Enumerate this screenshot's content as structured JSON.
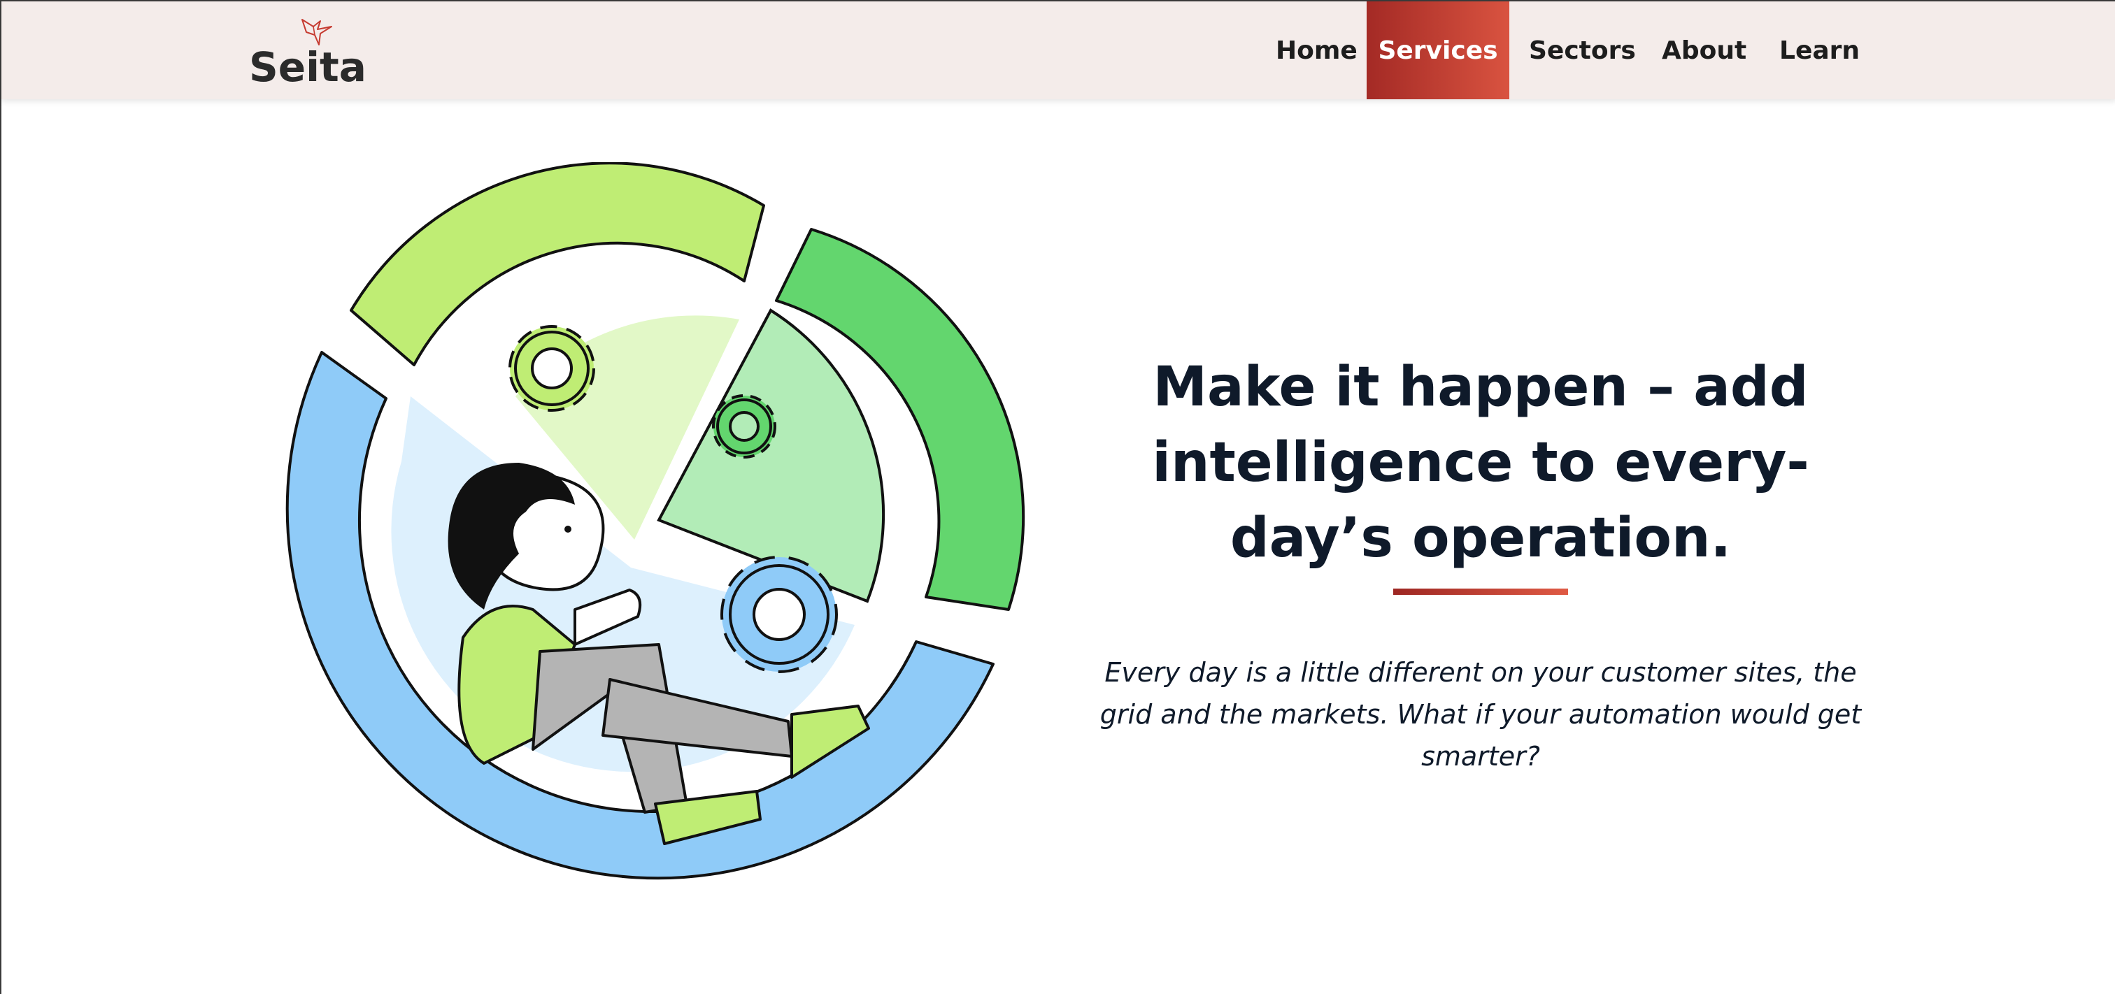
{
  "brand": {
    "name": "Seita",
    "accent_color": "#c63b31",
    "header_bg": "#f4ecea"
  },
  "nav": {
    "items": [
      {
        "label": "Home",
        "active": false
      },
      {
        "label": "Services",
        "active": true
      },
      {
        "label": "Sectors",
        "active": false
      },
      {
        "label": "About",
        "active": false
      },
      {
        "label": "Learn",
        "active": false
      }
    ]
  },
  "hero": {
    "title": "Make it happen – add intelligence to every-day’s operation.",
    "subtitle": "Every day is a little different on your customer sites, the grid and the markets. What if your automation would get smarter?"
  },
  "illustration": {
    "icon": "person-relaxing-in-gear-wheel-illustration",
    "colors": {
      "light_green": "#bfed74",
      "mid_green": "#63d66e",
      "blue": "#8fcbf8",
      "pale_blue": "#ddf0fd",
      "pale_green": "#e2f8c7",
      "pale_mint": "#b2ecb7"
    }
  }
}
